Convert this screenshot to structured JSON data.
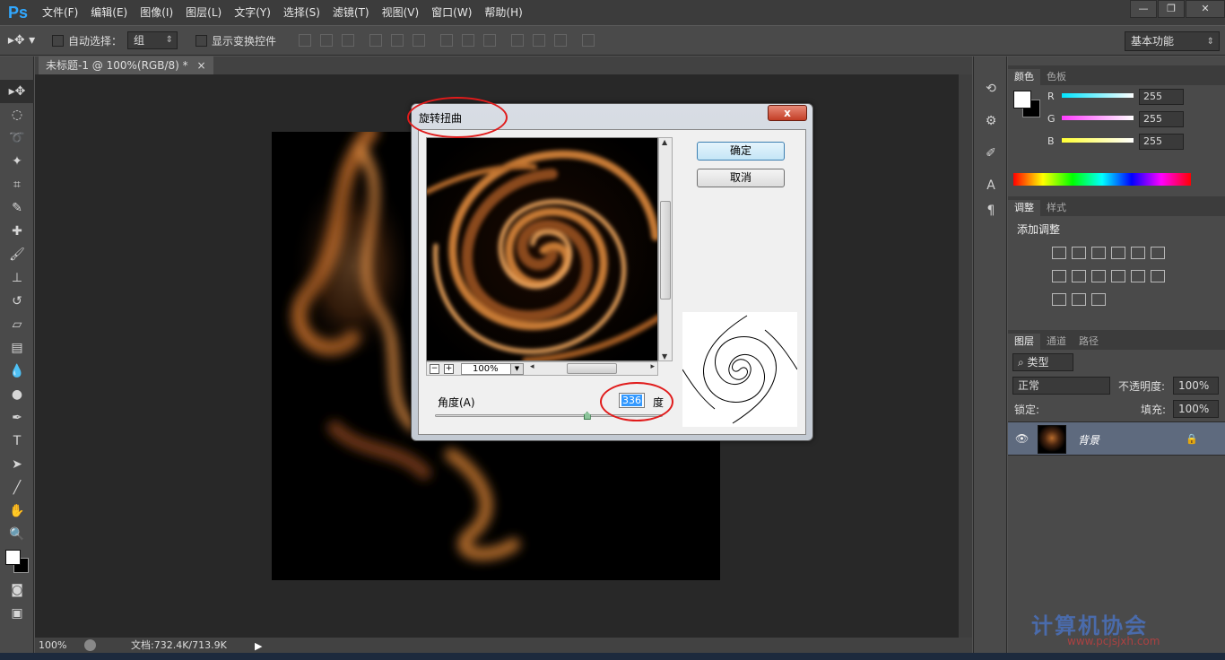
{
  "app": {
    "logo": "Ps"
  },
  "menu": [
    "文件(F)",
    "编辑(E)",
    "图像(I)",
    "图层(L)",
    "文字(Y)",
    "选择(S)",
    "滤镜(T)",
    "视图(V)",
    "窗口(W)",
    "帮助(H)"
  ],
  "options": {
    "auto_select_label": "自动选择：",
    "auto_select_value": "组",
    "show_transform_label": "显示变换控件",
    "workspace": "基本功能"
  },
  "document": {
    "tab_title": "未标题-1 @ 100%(RGB/8) *",
    "zoom": "100%",
    "doc_info": "文档:732.4K/713.9K"
  },
  "color_panel": {
    "tabs": [
      "颜色",
      "色板"
    ],
    "channels": [
      {
        "label": "R",
        "value": "255",
        "color": "#00e5ff"
      },
      {
        "label": "G",
        "value": "255",
        "color": "#ff3cff"
      },
      {
        "label": "B",
        "value": "255",
        "color": "#ffff33"
      }
    ]
  },
  "adjust_panel": {
    "tabs": [
      "调整",
      "样式"
    ],
    "title": "添加调整"
  },
  "layers_panel": {
    "tabs": [
      "图层",
      "通道",
      "路径"
    ],
    "filter_kind": "类型",
    "blend_mode": "正常",
    "opacity_label": "不透明度:",
    "opacity_value": "100%",
    "lock_label": "锁定:",
    "fill_label": "填充:",
    "fill_value": "100%",
    "layers": [
      {
        "name": "背景"
      }
    ]
  },
  "dialog": {
    "title": "旋转扭曲",
    "close_label": "x",
    "ok_label": "确定",
    "cancel_label": "取消",
    "zoom_value": "100%",
    "angle_label": "角度(A)",
    "angle_value": "336",
    "angle_unit": "度",
    "angle_slider": {
      "value": 336,
      "min": -999,
      "max": 999
    }
  },
  "watermark": {
    "name": "计算机协会",
    "url": "www.pcjsjxh.com"
  }
}
